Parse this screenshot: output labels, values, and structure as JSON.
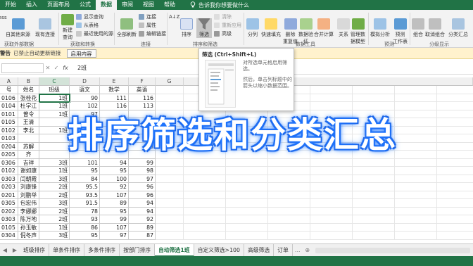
{
  "tabs": [
    {
      "label": "开始",
      "active": false
    },
    {
      "label": "插入",
      "active": false
    },
    {
      "label": "页面布局",
      "active": false
    },
    {
      "label": "公式",
      "active": false
    },
    {
      "label": "数据",
      "active": true
    },
    {
      "label": "审阅",
      "active": false
    },
    {
      "label": "视图",
      "active": false
    },
    {
      "label": "帮助",
      "active": false
    }
  ],
  "tell_me": "告诉我你想要做什么",
  "ribbon": {
    "get_data": {
      "label_partial": "ess",
      "from_web": "自其他来源",
      "existing_conn": "现有连接",
      "new_query": "新建",
      "new_query_line2": "查询",
      "show_queries": "显示查询",
      "from_table": "从表格",
      "recent_sources": "最近使用的源",
      "group_left": "获取外部数据",
      "group_transform": "获取和转换"
    },
    "connections": {
      "refresh_all": "全部刷新",
      "connections": "连接",
      "properties": "属性",
      "edit_links": "编辑链接",
      "group": "连接"
    },
    "sort_filter": {
      "sort_az": "A↓Z",
      "sort": "排序",
      "filter": "筛选",
      "clear": "清除",
      "reapply": "重新应用",
      "advanced": "高级",
      "group": "排序和筛选"
    },
    "data_tools": {
      "split": "分列",
      "flash_fill": "快速填充",
      "remove_dup": "删除",
      "remove_dup2": "重复值",
      "validation": "数据验",
      "validation2": "证",
      "consolidate": "合并计算",
      "relations": "关系",
      "manage_model": "管理数",
      "manage_model2": "据模型",
      "group": "数据工具"
    },
    "forecast": {
      "what_if": "模拟分析",
      "forecast_sheet": "预测",
      "forecast_sheet2": "工作表",
      "group": "预测"
    },
    "outline": {
      "group_btn": "组合",
      "ungroup": "取消组合",
      "subtotal": "分类汇总",
      "group": "分级显示"
    }
  },
  "security": {
    "title": "警告",
    "message": "已禁止自动更新链接",
    "button": "启用内容"
  },
  "formula_bar": {
    "cancel": "✕",
    "enter": "✓",
    "fx": "fx",
    "value": "2班"
  },
  "grid": {
    "columns": [
      "A",
      "B",
      "C",
      "D",
      "E",
      "F",
      "G"
    ],
    "header_row": [
      "号",
      "姓名",
      "班级",
      "语文",
      "数学",
      "英语"
    ],
    "rows": [
      [
        "0106",
        "张桂花",
        "1班",
        "90",
        "111",
        "116"
      ],
      [
        "0104",
        "杜学江",
        "1班",
        "102",
        "116",
        "113"
      ],
      [
        "0101",
        "曾令",
        "1班",
        "97",
        "",
        ""
      ],
      [
        "0105",
        "王清",
        "",
        "",
        "",
        ""
      ],
      [
        "0102",
        "李北",
        "1班",
        "",
        "58",
        ""
      ],
      [
        "0103",
        "",
        "",
        "",
        "",
        ""
      ],
      [
        "0204",
        "苏解",
        "",
        "",
        "",
        "93"
      ],
      [
        "0205",
        "齐",
        "",
        "",
        "",
        ""
      ],
      [
        "0306",
        "吉祥",
        "3班",
        "101",
        "94",
        "99"
      ],
      [
        "0102",
        "谢如康",
        "1班",
        "95",
        "95",
        "98"
      ],
      [
        "0303",
        "闫朝霞",
        "3班",
        "84",
        "100",
        "97"
      ],
      [
        "0203",
        "刘康锋",
        "2班",
        "95.5",
        "92",
        "96"
      ],
      [
        "0201",
        "刘鹏举",
        "2班",
        "93.5",
        "107",
        "96"
      ],
      [
        "0305",
        "包宏伟",
        "3班",
        "91.5",
        "89",
        "94"
      ],
      [
        "0202",
        "李娜娜",
        "2班",
        "78",
        "95",
        "94"
      ],
      [
        "0303",
        "陈万地",
        "2班",
        "93",
        "99",
        "92"
      ],
      [
        "0105",
        "孙玉敏",
        "1班",
        "86",
        "107",
        "89"
      ],
      [
        "0304",
        "倪冬声",
        "3班",
        "95",
        "97",
        "87"
      ]
    ]
  },
  "tooltip": {
    "title": "筛选 (Ctrl+Shift+L)",
    "desc1": "对所选单元格启用筛选。",
    "desc2": "然后，单击列标题中的箭头以缩小数据范围。"
  },
  "overlay_title": "排序筛选和分类汇总",
  "sheet_tabs": [
    {
      "label": "班级排序",
      "active": false
    },
    {
      "label": "单条件排序",
      "active": false
    },
    {
      "label": "多条件排序",
      "active": false
    },
    {
      "label": "按部门排序",
      "active": false
    },
    {
      "label": "自动筛选1班",
      "active": true
    },
    {
      "label": "自定义筛选>100",
      "active": false
    },
    {
      "label": "高级筛选",
      "active": false
    },
    {
      "label": "订单",
      "active": false
    }
  ],
  "sheet_nav": {
    "prev": "◀",
    "next": "▶",
    "more": "...",
    "add": "⊕"
  },
  "colors": {
    "excel_green": "#217346",
    "ribbon_bg": "#f3f3f3",
    "security_bg": "#fff2cd",
    "overlay_glow": "#1a72ff"
  }
}
